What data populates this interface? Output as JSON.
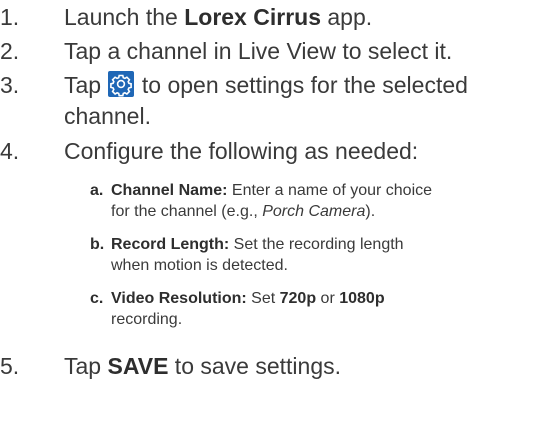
{
  "steps": [
    {
      "num": "1.",
      "pre": "Launch the ",
      "bold": "Lorex Cirrus",
      "post": " app."
    },
    {
      "num": "2.",
      "text": "Tap a channel in Live View to select it."
    },
    {
      "num": "3.",
      "pre": "Tap ",
      "post_line1": " to open settings for the selected",
      "line2": "channel.",
      "icon": "settings-gear-icon",
      "icon_color": "#1f67b6"
    },
    {
      "num": "4.",
      "text": "Configure the following as needed:"
    },
    {
      "num": "5.",
      "pre": "Tap ",
      "bold": "SAVE",
      "post": " to save settings."
    }
  ],
  "substeps": [
    {
      "letter": "a.",
      "bold": "Channel Name:",
      "line1": " Enter a name of your choice",
      "line2_pre": "for the channel (e.g., ",
      "line2_italic": "Porch Camera",
      "line2_post": ")."
    },
    {
      "letter": "b.",
      "bold": "Record Length:",
      "line1": " Set the recording length",
      "line2": "when motion is detected."
    },
    {
      "letter": "c.",
      "bold": "Video Resolution:",
      "line1_a": " Set ",
      "bold_b": "720p",
      "line1_c": " or ",
      "bold_d": "1080p",
      "line2": "recording."
    }
  ]
}
